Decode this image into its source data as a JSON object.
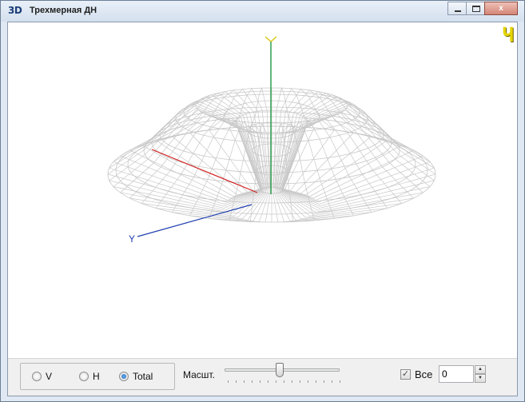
{
  "window": {
    "icon_text": "3D",
    "title": "Трехмерная ДН",
    "minimize_label": "",
    "maximize_label": "",
    "close_label": "x"
  },
  "viewport": {
    "corner_glyph": "Ч",
    "axis_labels": {
      "y": "Y"
    },
    "colors": {
      "mesh": "#c8c8c8",
      "z_axis": "#2e9e4e",
      "x_axis": "#d42020",
      "y_axis": "#1f3fb0",
      "corner_glyph": "#e6d400"
    }
  },
  "controls": {
    "pattern_mode": {
      "options": [
        {
          "label": "V",
          "selected": false
        },
        {
          "label": "H",
          "selected": false
        },
        {
          "label": "Total",
          "selected": true
        }
      ]
    },
    "scale_label": "Масшт.",
    "scale_slider_fraction": 0.48,
    "all_checkbox": {
      "label": "Все",
      "checked": true,
      "mark": "✓"
    },
    "value_input": "0",
    "spin_up": "▲",
    "spin_down": "▼"
  }
}
